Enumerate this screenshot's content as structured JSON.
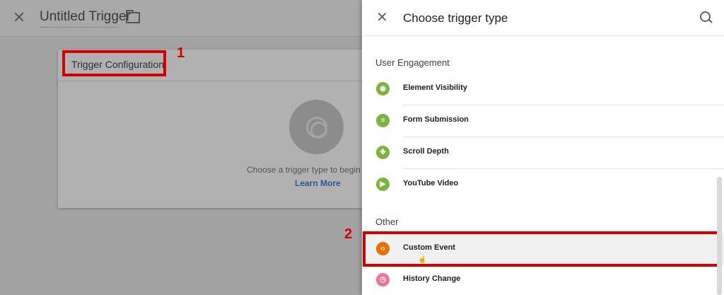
{
  "editor": {
    "title": "Untitled Trigger",
    "card_title": "Trigger Configuration",
    "empty_text": "Choose a trigger type to begin s",
    "learn_more": "Learn More"
  },
  "annotations": {
    "step1": "1",
    "step2": "2"
  },
  "panel": {
    "title": "Choose trigger type",
    "sections": [
      {
        "title": "User Engagement",
        "items": [
          {
            "label": "Element Visibility",
            "icon": "eye-icon",
            "color": "#7cb342"
          },
          {
            "label": "Form Submission",
            "icon": "form-icon",
            "color": "#7cb342"
          },
          {
            "label": "Scroll Depth",
            "icon": "scroll-icon",
            "color": "#7cb342"
          },
          {
            "label": "YouTube Video",
            "icon": "play-icon",
            "color": "#7cb342"
          }
        ]
      },
      {
        "title": "Other",
        "items": [
          {
            "label": "Custom Event",
            "icon": "code-icon",
            "color": "#e8710a"
          },
          {
            "label": "History Change",
            "icon": "history-icon",
            "color": "#e8769a"
          }
        ]
      }
    ]
  },
  "colors": {
    "highlight": "#d40000",
    "link": "#2b5797"
  }
}
